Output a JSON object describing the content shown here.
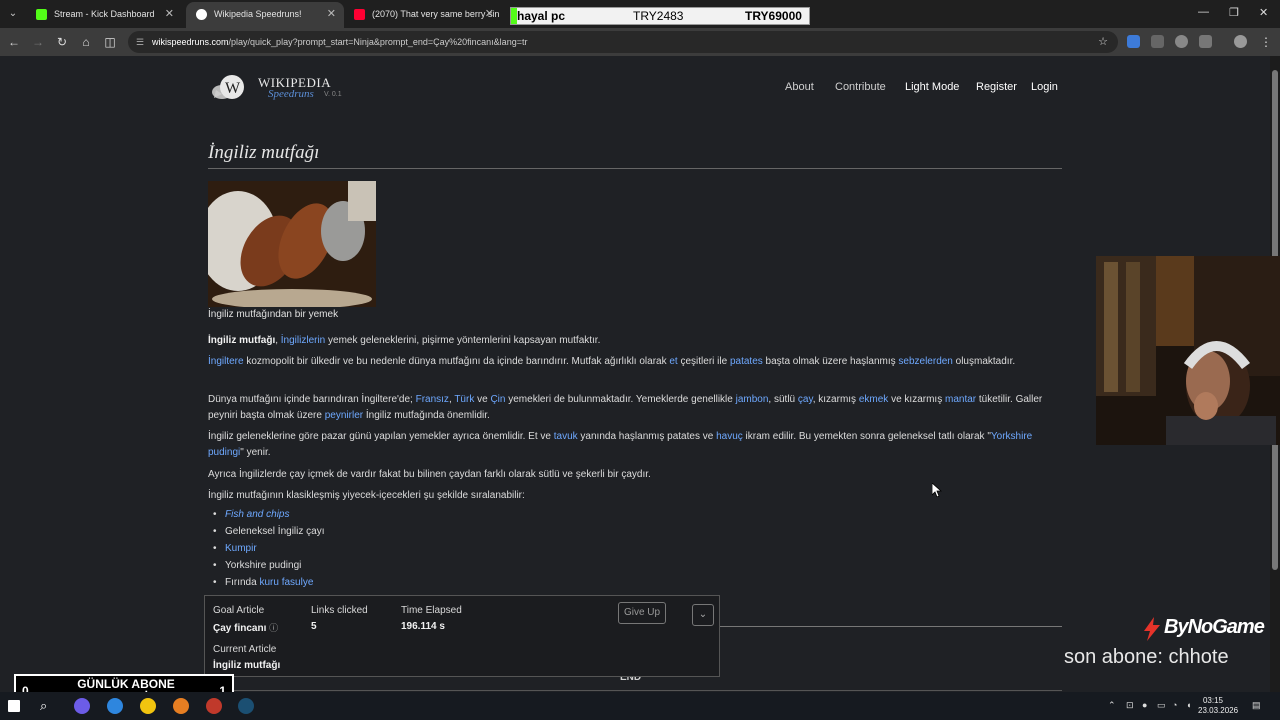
{
  "browser": {
    "tabs": [
      {
        "title": "Stream - Kick Dashboard",
        "active": false,
        "color": "#53fc18"
      },
      {
        "title": "Wikipedia Speedruns!",
        "active": true,
        "color": "#ffffff"
      },
      {
        "title": "(2070) That very same berry sin",
        "active": false,
        "color": "#ff0033"
      }
    ],
    "url_host": "wikispeedruns.com",
    "url_path": "/play/quick_play?prompt_start=Ninja&prompt_end=Çay%20fincanı&lang=tr"
  },
  "price_overlay": {
    "name": "hayal pc",
    "current": "TRY2483",
    "target": "TRY69000"
  },
  "site": {
    "logo_wiki": "WIKIPEDIA",
    "logo_speedruns": "Speedruns",
    "logo_version": "V. 0.1",
    "nav": [
      "About",
      "Contribute",
      "Light Mode",
      "Register",
      "Login"
    ]
  },
  "article": {
    "title": "İngiliz mutfağı",
    "caption": "İngiliz mutfağından bir yemek",
    "p1": {
      "b": "İngiliz mutfağı",
      "t1": ", ",
      "l1": "İngilizlerin",
      "t2": " yemek geleneklerini, pişirme yöntemlerini kapsayan mutfaktır."
    },
    "p2": {
      "l1": "İngiltere",
      "t1": " kozmopolit bir ülkedir ve bu nedenle dünya mutfağını da içinde barındırır. Mutfak ağırlıklı olarak ",
      "l2": "et",
      "t2": " çeşitleri ile ",
      "l3": "patates",
      "t3": " başta olmak üzere haşlanmış ",
      "l4": "sebzelerden",
      "t4": " oluşmaktadır."
    },
    "p3": {
      "t1": "Dünya mutfağını içinde barındıran İngiltere'de; ",
      "l1": "Fransız",
      "t2": ", ",
      "l2": "Türk",
      "t3": " ve ",
      "l3": "Çin",
      "t4": " yemekleri de bulunmaktadır. Yemeklerde genellikle ",
      "l4": "jambon",
      "t5": ", sütlü ",
      "l5": "çay",
      "t6": ", kızarmış ",
      "l6": "ekmek",
      "t7": " ve kızarmış ",
      "l7": "mantar",
      "t8": " tüketilir. Galler peyniri başta olmak üzere ",
      "l8": "peynirler",
      "t9": " İngiliz mutfağında önemlidir."
    },
    "p4": {
      "t1": "İngiliz geleneklerine göre pazar günü yapılan yemekler ayrıca önemlidir. Et ve ",
      "l1": "tavuk",
      "t2": " yanında haşlanmış patates ve ",
      "l2": "havuç",
      "t3": " ikram edilir. Bu yemekten sonra geleneksel tatlı olarak \"",
      "l3": "Yorkshire pudingi",
      "t4": "\" yenir."
    },
    "p5": "Ayrıca İngilizlerde çay içmek de vardır fakat bu bilinen çaydan farklı olarak sütlü ve şekerli bir çaydır.",
    "p6": "İngiliz mutfağının klasikleşmiş yiyecek-içecekleri şu şekilde sıralanabilir:",
    "list": {
      "i1": "Fish and chips",
      "i2": "Geleneksel İngiliz çayı",
      "i3": "Kumpir",
      "i4": "Yorkshire pudingi",
      "i5_text": "Fırında ",
      "i5_link": "kuru fasulye"
    },
    "end_label": "END"
  },
  "status": {
    "goal_label": "Goal Article",
    "goal_value": "Çay fincanı",
    "links_label": "Links clicked",
    "links_value": "5",
    "time_label": "Time Elapsed",
    "time_value": "196.114 s",
    "current_label": "Current Article",
    "current_value": "İngiliz mutfağı",
    "giveup_label": "Give Up"
  },
  "stream_overlay": {
    "brand": "ByNoGame",
    "last_sub": "son abone: chhote",
    "goal_text": "GÜNLÜK ABONE HEDEFİ",
    "goal_current": "0",
    "goal_target": "1"
  },
  "taskbar": {
    "time": "03:15",
    "date": "23.03.2026"
  }
}
